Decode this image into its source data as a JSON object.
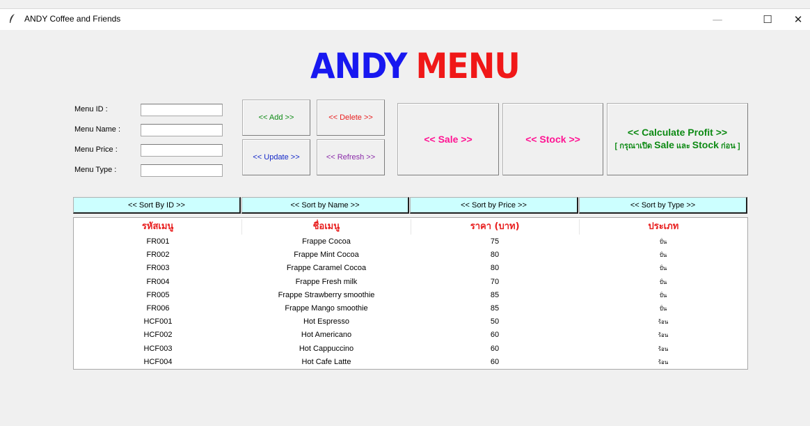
{
  "window": {
    "title": "ANDY Coffee and Friends",
    "minimize": "—",
    "maximize": "☐",
    "close": "✕"
  },
  "logo": {
    "word1": "ANDY",
    "word2": "MENU"
  },
  "form": {
    "menu_id_label": "Menu ID :",
    "menu_name_label": "Menu Name :",
    "menu_price_label": "Menu Price :",
    "menu_type_label": "Menu Type :",
    "menu_id_value": "",
    "menu_name_value": "",
    "menu_price_value": "",
    "menu_type_value": ""
  },
  "buttons": {
    "add": "<< Add >>",
    "delete": "<< Delete >>",
    "update": "<< Update >>",
    "refresh": "<< Refresh >>",
    "sale": "<< Sale >>",
    "stock": "<< Stock >>",
    "calc_line1": "<< Calculate Profit >>",
    "calc_pre": "[ กรุณาเปิด ",
    "calc_sale": "Sale",
    "calc_mid": " และ ",
    "calc_stock": "Stock",
    "calc_post": " ก่อน ]"
  },
  "sort_buttons": {
    "by_id": "<< Sort By ID >>",
    "by_name": "<< Sort by Name >>",
    "by_price": "<< Sort by Price >>",
    "by_type": "<< Sort by Type >>"
  },
  "table": {
    "headers": [
      "รหัสเมนู",
      "ชื่อเมนู",
      "ราคา (บาท)",
      "ประเภท"
    ],
    "rows": [
      [
        "FR001",
        "Frappe  Cocoa",
        "75",
        "ปั่น"
      ],
      [
        "FR002",
        "Frappe Mint Cocoa",
        "80",
        "ปั่น"
      ],
      [
        "FR003",
        "Frappe Caramel Cocoa",
        "80",
        "ปั่น"
      ],
      [
        "FR004",
        "Frappe Fresh milk",
        "70",
        "ปั่น"
      ],
      [
        "FR005",
        "Frappe Strawberry smoothie",
        "85",
        "ปั่น"
      ],
      [
        "FR006",
        "Frappe Mango smoothie",
        "85",
        "ปั่น"
      ],
      [
        "HCF001",
        "Hot Espresso",
        "50",
        "ร้อน"
      ],
      [
        "HCF002",
        "Hot Americano",
        "60",
        "ร้อน"
      ],
      [
        "HCF003",
        "Hot Cappuccino",
        "60",
        "ร้อน"
      ],
      [
        "HCF004",
        "Hot Cafe Latte",
        "60",
        "ร้อน"
      ]
    ]
  },
  "colors": {
    "logo_blue": "#1818f0",
    "logo_red": "#f01818",
    "sort_bg": "#ccffff",
    "header_red": "#e81d1d",
    "pink": "#ff1493",
    "green": "#0d8a14"
  }
}
